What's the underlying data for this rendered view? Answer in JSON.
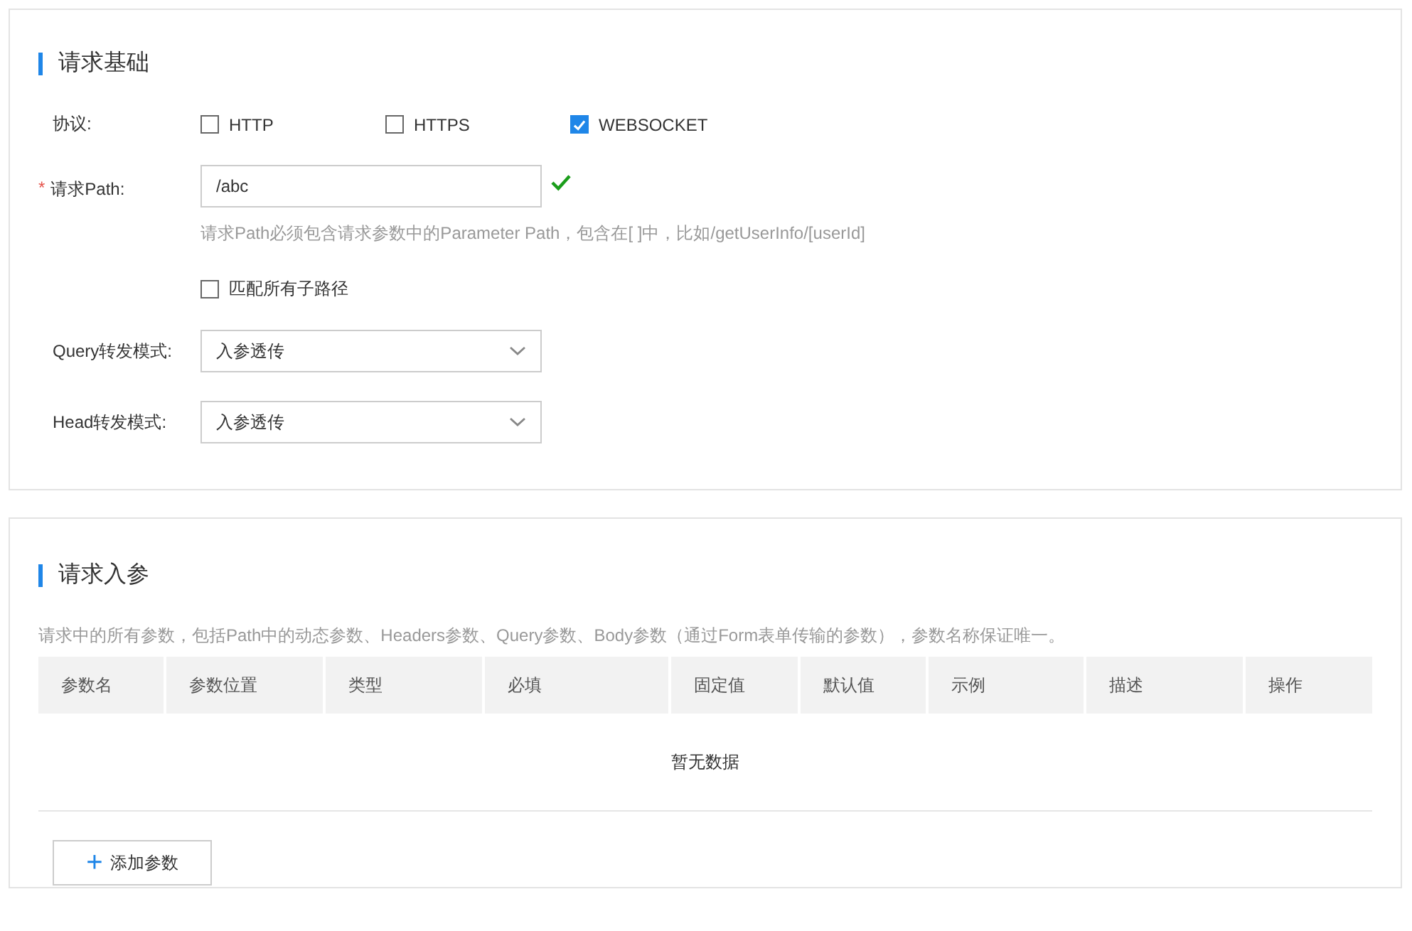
{
  "basic": {
    "title": "请求基础",
    "protocol": {
      "label": "协议:",
      "options": [
        {
          "label": "HTTP",
          "checked": false
        },
        {
          "label": "HTTPS",
          "checked": false
        },
        {
          "label": "WEBSOCKET",
          "checked": true
        }
      ]
    },
    "path": {
      "label": "请求Path:",
      "required_mark": "*",
      "value": "/abc",
      "valid": true,
      "hint": "请求Path必须包含请求参数中的Parameter Path，包含在[ ]中，比如/getUserInfo/[userId]"
    },
    "match_all": {
      "label": "匹配所有子路径",
      "checked": false
    },
    "selects": [
      {
        "label": "Query转发模式:",
        "value": "入参透传"
      },
      {
        "label": "Head转发模式:",
        "value": "入参透传"
      }
    ]
  },
  "params": {
    "title": "请求入参",
    "description": "请求中的所有参数，包括Path中的动态参数、Headers参数、Query参数、Body参数（通过Form表单传输的参数），参数名称保证唯一。",
    "table": {
      "columns": [
        "参数名",
        "参数位置",
        "类型",
        "必填",
        "固定值",
        "默认值",
        "示例",
        "描述",
        "操作"
      ],
      "empty_text": "暂无数据"
    },
    "add_button": {
      "icon": "+",
      "label": "添加参数"
    }
  }
}
